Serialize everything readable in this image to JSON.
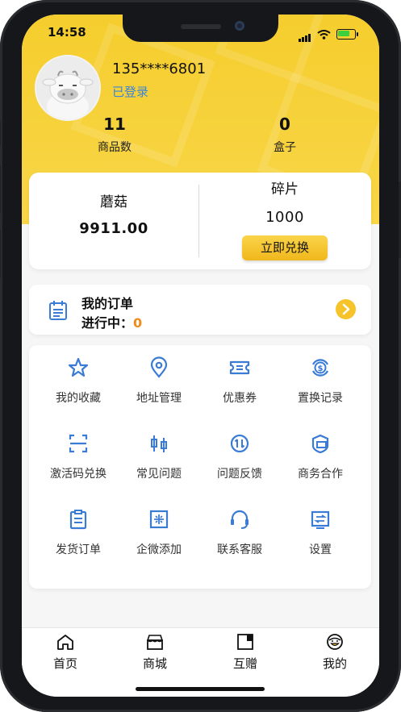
{
  "status_bar": {
    "time": "14:58"
  },
  "profile": {
    "phone": "135****6801",
    "status": "已登录"
  },
  "stats": [
    {
      "value": "11",
      "label": "商品数"
    },
    {
      "value": "0",
      "label": "盒子"
    }
  ],
  "wallet": {
    "mushroom": {
      "title": "蘑菇",
      "value": "9911.00"
    },
    "fragments": {
      "title": "碎片",
      "value": "1000"
    },
    "exchange_label": "立即兑换"
  },
  "orders": {
    "title": "我的订单",
    "progress_label": "进行中：",
    "progress_count": "0"
  },
  "menu": [
    {
      "label": "我的收藏",
      "icon": "star-icon"
    },
    {
      "label": "地址管理",
      "icon": "location-pin-icon"
    },
    {
      "label": "优惠券",
      "icon": "coupon-icon"
    },
    {
      "label": "置换记录",
      "icon": "exchange-record-icon"
    },
    {
      "label": "激活码兑换",
      "icon": "scan-code-icon"
    },
    {
      "label": "常见问题",
      "icon": "faq-icon"
    },
    {
      "label": "问题反馈",
      "icon": "feedback-icon"
    },
    {
      "label": "商务合作",
      "icon": "business-icon"
    },
    {
      "label": "发货订单",
      "icon": "shipping-order-icon"
    },
    {
      "label": "企微添加",
      "icon": "wecom-icon"
    },
    {
      "label": "联系客服",
      "icon": "headset-icon"
    },
    {
      "label": "设置",
      "icon": "settings-icon"
    }
  ],
  "tabs": [
    {
      "label": "首页",
      "icon": "home-icon"
    },
    {
      "label": "商城",
      "icon": "store-icon"
    },
    {
      "label": "互赠",
      "icon": "gift-exchange-icon"
    },
    {
      "label": "我的",
      "icon": "profile-face-icon"
    }
  ],
  "colors": {
    "accent": "#f5cd2d",
    "icon_blue": "#3a7bd5",
    "progress_orange": "#f08a1c"
  }
}
